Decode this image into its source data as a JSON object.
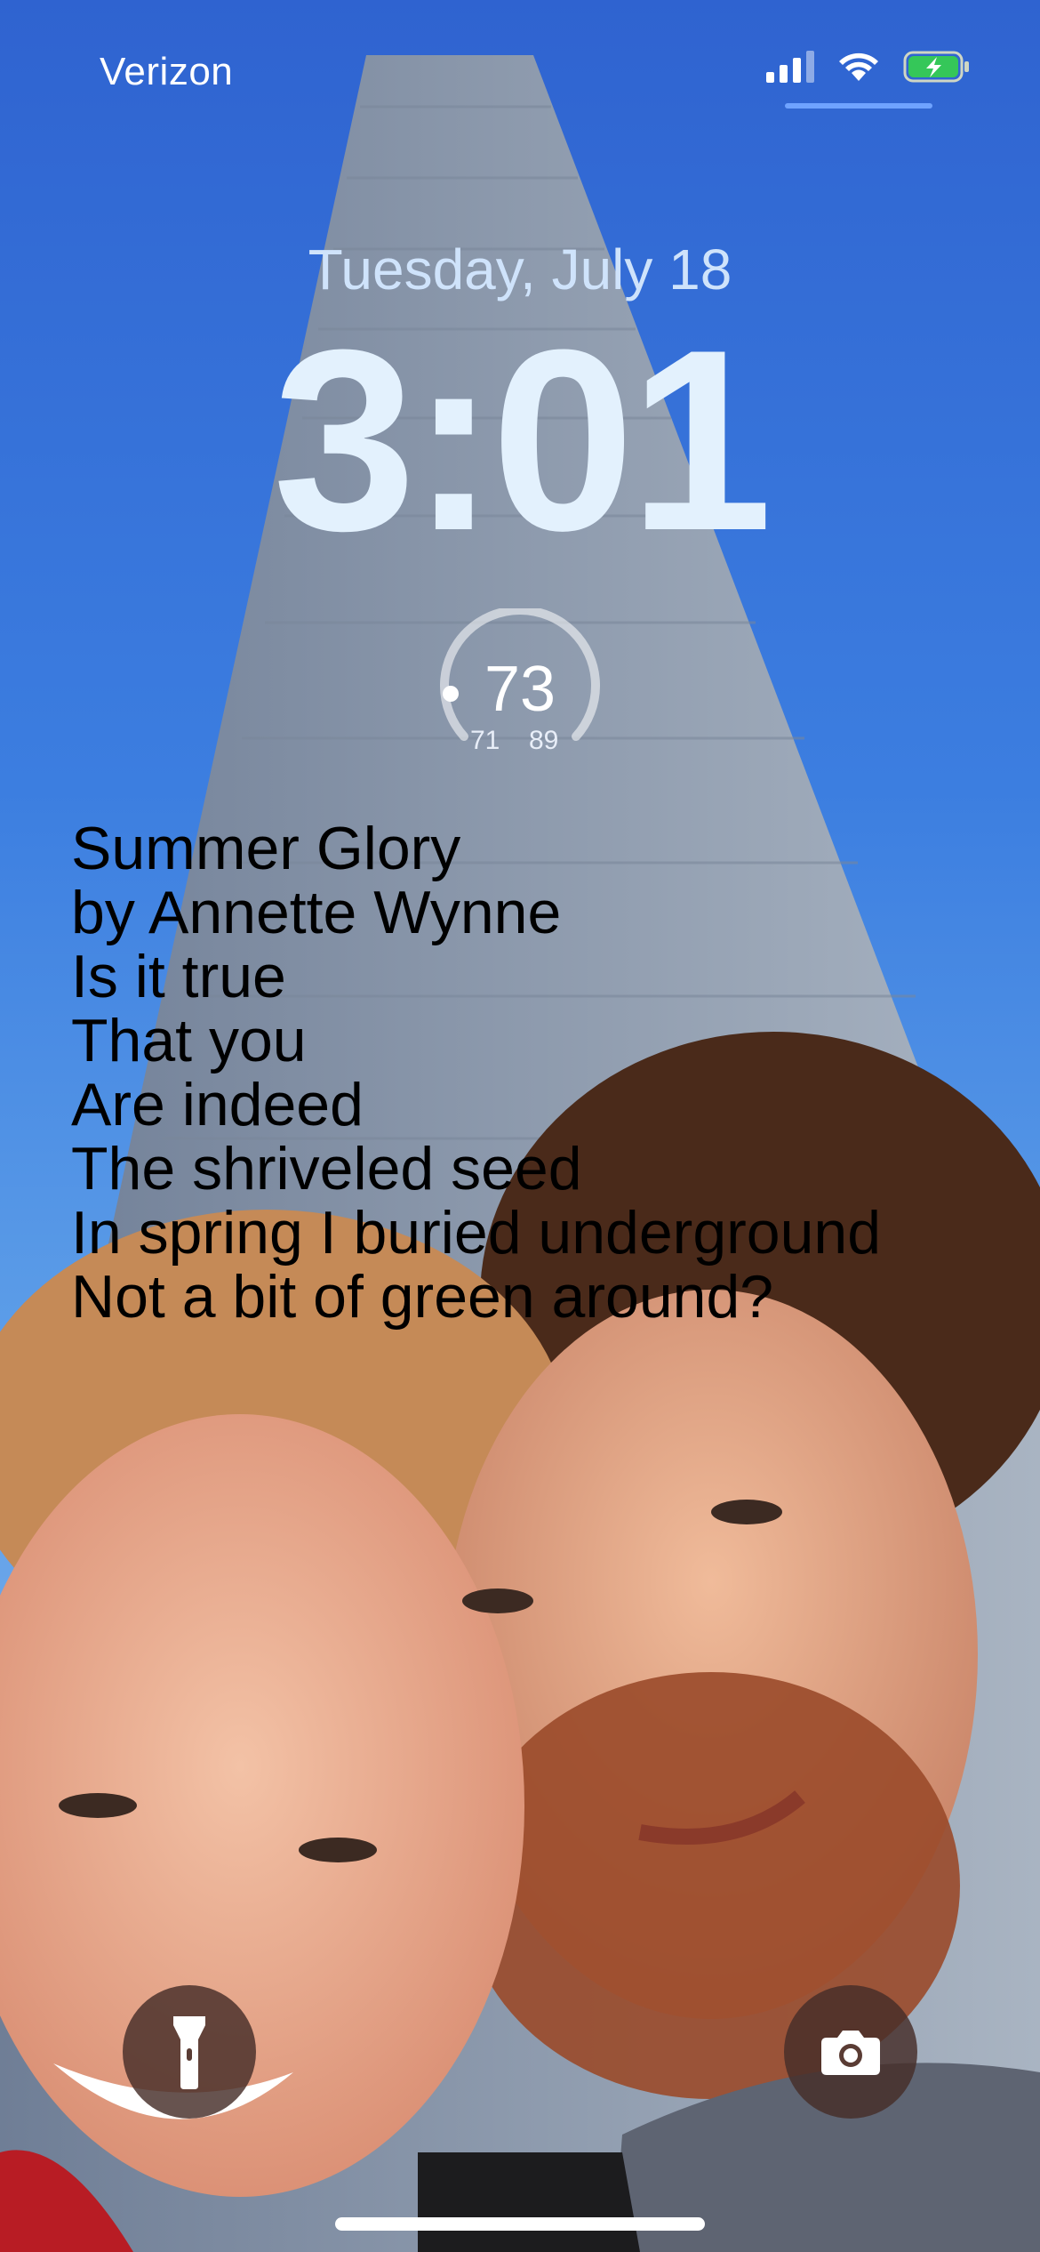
{
  "status_bar": {
    "carrier": "Verizon",
    "signal_bars_active": 3,
    "signal_bars_total": 4,
    "battery_state": "charging",
    "icons": [
      "cellular-signal-icon",
      "wifi-icon",
      "battery-charging-icon"
    ],
    "accent_color": "#6fa3ff"
  },
  "lock_screen": {
    "date": "Tuesday, July 18",
    "time": "3:01"
  },
  "weather": {
    "current": "73",
    "low": "71",
    "high": "89"
  },
  "poem": {
    "lines": [
      "Summer Glory",
      "by Annette Wynne",
      "Is it true",
      "That you",
      "Are indeed",
      "The shriveled seed",
      "In spring I buried underground",
      "Not a bit of green around?"
    ]
  },
  "quick_actions": {
    "left": "flashlight-icon",
    "right": "camera-icon"
  }
}
